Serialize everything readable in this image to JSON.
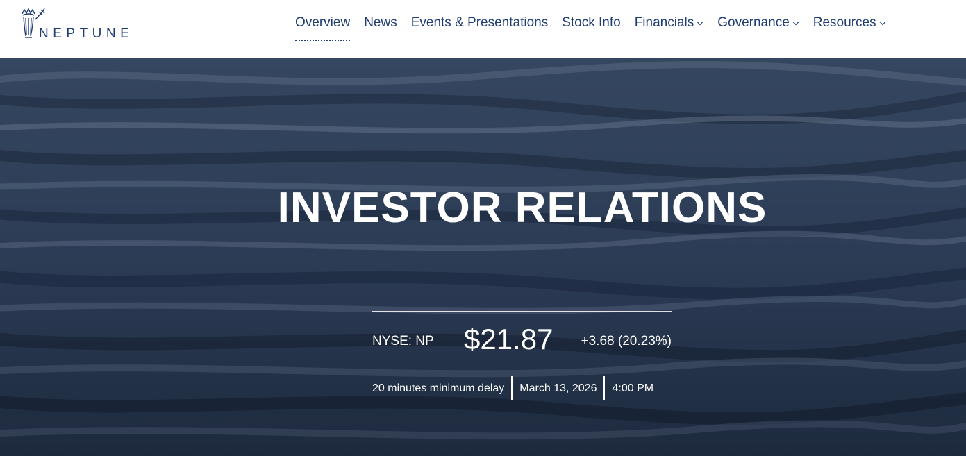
{
  "header": {
    "logo_text": "NEPTUNE",
    "nav": [
      {
        "label": "Overview",
        "active": true,
        "dropdown": false
      },
      {
        "label": "News",
        "active": false,
        "dropdown": false
      },
      {
        "label": "Events & Presentations",
        "active": false,
        "dropdown": false
      },
      {
        "label": "Stock Info",
        "active": false,
        "dropdown": false
      },
      {
        "label": "Financials",
        "active": false,
        "dropdown": true
      },
      {
        "label": "Governance",
        "active": false,
        "dropdown": true
      },
      {
        "label": "Resources",
        "active": false,
        "dropdown": true
      }
    ]
  },
  "hero": {
    "title": "INVESTOR RELATIONS"
  },
  "quote": {
    "ticker": "NYSE: NP",
    "price": "$21.87",
    "change": "+3.68 (20.23%)",
    "delay": "20 minutes minimum delay",
    "date": "March 13, 2026",
    "time": "4:00 PM"
  },
  "colors": {
    "brand": "#1f3d75",
    "hero_bg": "#2a3a52",
    "text_on_hero": "#ffffff"
  },
  "icons": {
    "logo": "neptune-trident-logo-icon",
    "dropdown": "chevron-down-icon"
  }
}
